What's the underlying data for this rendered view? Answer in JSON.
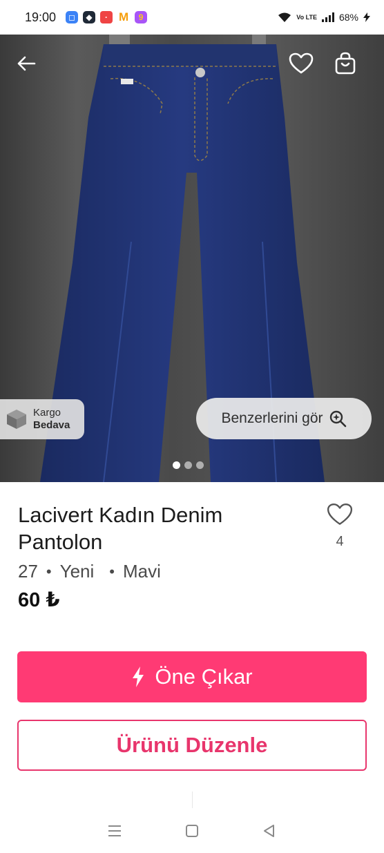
{
  "status_bar": {
    "time": "19:00",
    "battery": "68%",
    "network": "Vo LTE",
    "app_icons": [
      "app-blue-icon",
      "app-cube-icon",
      "app-red-icon",
      "app-m-icon",
      "app-g-icon"
    ]
  },
  "header": {
    "back_icon": "arrow-left-icon",
    "favorite_icon": "heart-outline-icon",
    "cart_icon": "shopping-bag-icon"
  },
  "image": {
    "cargo_badge": {
      "line1": "Kargo",
      "line2": "Bedava",
      "icon": "box-icon"
    },
    "similar_button": {
      "label": "Benzerlerini gör",
      "icon": "search-sparkle-icon"
    },
    "page_count": 3,
    "active_page": 1
  },
  "product": {
    "title": "Lacivert Kadın Denim Pantolon",
    "size": "27",
    "condition": "Yeni",
    "brand": "Mavi",
    "bullet": "•",
    "price": "60 ₺",
    "favorite_count": "4"
  },
  "actions": {
    "promote_label": "Öne Çıkar",
    "edit_label": "Ürünü Düzenle"
  },
  "colors": {
    "primary": "#ff3a74",
    "primary_text": "#e8356c",
    "denim": "#1f3270"
  },
  "navigation": {
    "recent_icon": "menu-lines-icon",
    "home_icon": "square-home-icon",
    "back_icon": "triangle-back-icon"
  }
}
